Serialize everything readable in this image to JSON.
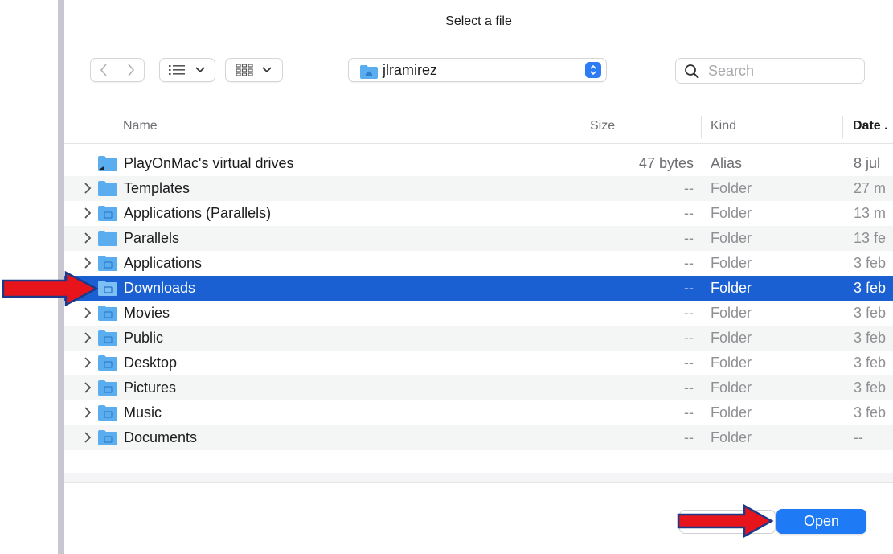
{
  "window": {
    "title": "Select a file"
  },
  "toolbar": {
    "back_icon": "chevron-left-icon",
    "forward_icon": "chevron-right-icon",
    "list_view_icon": "list-view-icon",
    "grid_view_icon": "grid-view-icon",
    "location": "jlramirez",
    "search_placeholder": "Search"
  },
  "columns": {
    "name": "Name",
    "size": "Size",
    "kind": "Kind",
    "date": "Date ."
  },
  "files": [
    {
      "name": "PlayOnMac's virtual drives",
      "size": "47 bytes",
      "kind": "Alias",
      "date": "8 jul",
      "expandable": false,
      "icon": "alias-folder-icon"
    },
    {
      "name": "Templates",
      "size": "--",
      "kind": "Folder",
      "date": "27 m",
      "expandable": true,
      "icon": "folder-icon"
    },
    {
      "name": "Applications (Parallels)",
      "size": "--",
      "kind": "Folder",
      "date": "13 m",
      "expandable": true,
      "icon": "parallels-folder-icon"
    },
    {
      "name": "Parallels",
      "size": "--",
      "kind": "Folder",
      "date": "13 fe",
      "expandable": true,
      "icon": "folder-icon"
    },
    {
      "name": "Applications",
      "size": "--",
      "kind": "Folder",
      "date": "3 feb",
      "expandable": true,
      "icon": "applications-folder-icon"
    },
    {
      "name": "Downloads",
      "size": "--",
      "kind": "Folder",
      "date": "3 feb",
      "expandable": true,
      "icon": "downloads-folder-icon",
      "selected": true
    },
    {
      "name": "Movies",
      "size": "--",
      "kind": "Folder",
      "date": "3 feb",
      "expandable": true,
      "icon": "movies-folder-icon"
    },
    {
      "name": "Public",
      "size": "--",
      "kind": "Folder",
      "date": "3 feb",
      "expandable": true,
      "icon": "public-folder-icon"
    },
    {
      "name": "Desktop",
      "size": "--",
      "kind": "Folder",
      "date": "3 feb",
      "expandable": true,
      "icon": "desktop-folder-icon"
    },
    {
      "name": "Pictures",
      "size": "--",
      "kind": "Folder",
      "date": "3 feb",
      "expandable": true,
      "icon": "pictures-folder-icon"
    },
    {
      "name": "Music",
      "size": "--",
      "kind": "Folder",
      "date": "3 feb",
      "expandable": true,
      "icon": "music-folder-icon"
    },
    {
      "name": "Documents",
      "size": "--",
      "kind": "Folder",
      "date": "--",
      "expandable": true,
      "icon": "documents-folder-icon"
    }
  ],
  "buttons": {
    "open": "Open"
  },
  "colors": {
    "selection": "#1a60d2",
    "accent": "#1f7af5",
    "folder": "#5aaef0",
    "arrow": "#e8141b",
    "arrow_outline": "#1d3a8a"
  }
}
